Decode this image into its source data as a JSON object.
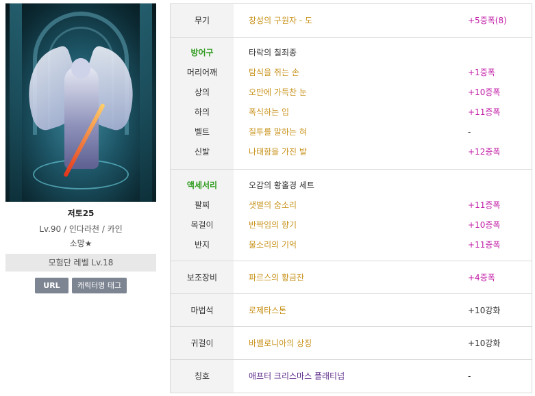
{
  "character": {
    "name": "저토25",
    "info": "Lv.90 / 인다라천 / 카인",
    "hope": "소망★",
    "adventure_level": "모험단 레벨 Lv.18",
    "url_button": "URL",
    "tag_button": "캐릭터명 태그"
  },
  "equipment": {
    "weapon": {
      "label": "무기",
      "item": "창성의 구원자 - 도",
      "value": "+5증폭(8)"
    },
    "armor": {
      "label": "방어구",
      "set_name": "타락의 칠죄종",
      "rows": [
        {
          "label": "머리어깨",
          "item": "탐식을 쥐는 손",
          "value": "+1증폭"
        },
        {
          "label": "상의",
          "item": "오만에 가득찬 눈",
          "value": "+10증폭"
        },
        {
          "label": "하의",
          "item": "폭식하는 입",
          "value": "+11증폭"
        },
        {
          "label": "벨트",
          "item": "질투를 말하는 혀",
          "value": "-"
        },
        {
          "label": "신발",
          "item": "나태함을 가진 발",
          "value": "+12증폭"
        }
      ]
    },
    "accessory": {
      "label": "액세서리",
      "set_name": "오감의 황홀경 세트",
      "rows": [
        {
          "label": "팔찌",
          "item": "샛별의 숨소리",
          "value": "+11증폭"
        },
        {
          "label": "목걸이",
          "item": "반짝임의 향기",
          "value": "+10증폭"
        },
        {
          "label": "반지",
          "item": "물소리의 기억",
          "value": "+11증폭"
        }
      ]
    },
    "sub": {
      "label": "보조장비",
      "item": "파르스의 황금잔",
      "value": "+4증폭"
    },
    "magic_stone": {
      "label": "마법석",
      "item": "로제타스톤",
      "value": "+10강화"
    },
    "earring": {
      "label": "귀걸이",
      "item": "바벨로니아의 상징",
      "value": "+10강화"
    },
    "title": {
      "label": "칭호",
      "item": "애프터 크리스마스 플래티넘",
      "value": "-"
    }
  },
  "colors": {
    "item_gold": "#c8931c",
    "amplify_magenta": "#c01ca6",
    "category_green": "#2f9b1e",
    "title_purple": "#5b2a8a"
  }
}
